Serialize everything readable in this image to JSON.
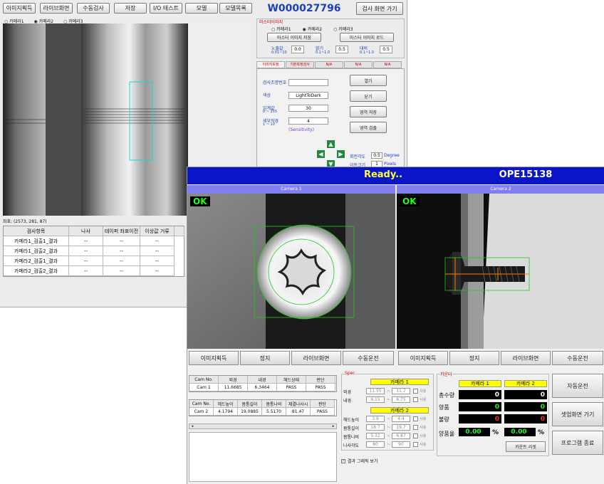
{
  "back": {
    "toolbar": [
      "이미지획득",
      "라이브화면",
      "수동검사",
      "저장",
      "I/O 테스트",
      "모델",
      "모델목록"
    ],
    "model_id": "W000027796",
    "exit_btn": "검사 화면 가기",
    "cam_radios": [
      "카메라1",
      "카메라2",
      "카메라3"
    ],
    "cam_radios_selected": 1,
    "master_group": "마스터이미지",
    "master_radios": [
      "카메라1",
      "카메라2",
      "카메라3"
    ],
    "master_save": "마스터 이미지 저장",
    "master_load": "마스터 이미지 로드",
    "params": [
      {
        "label": "노출값",
        "sub": "0.01~10",
        "value": "0.0"
      },
      {
        "label": "밝기",
        "sub": "0.1~1.0",
        "value": "0.5"
      },
      {
        "label": "대비",
        "sub": "0.1~1.0",
        "value": "0.5"
      }
    ],
    "tabs": [
      "이미지보정",
      "기본측정검사",
      "N/A",
      "N/A",
      "N/A"
    ],
    "form": [
      {
        "label": "검사조명번호",
        "value": ""
      },
      {
        "label": "색상",
        "value": "LightToDark"
      },
      {
        "label": "임계값",
        "sub": "0 ~ 255",
        "value": "30"
      },
      {
        "label": "세부직경",
        "sub": "1 ~ 10",
        "value": "4"
      }
    ],
    "form_note": "(Sensitivity)",
    "side_buttons": [
      "열기",
      "닫기",
      "영역 저장",
      "영역 검출"
    ],
    "move_labels": [
      {
        "label": "회전각도",
        "value": "0.5",
        "unit": "Degree"
      },
      {
        "label": "이동크기",
        "value": "1",
        "unit": "Pixels"
      }
    ],
    "status_line": "좌표: (2573, 281, 87)",
    "table_headers": [
      "검사항목",
      "나사",
      "테이퍼 좌표이전",
      "이상값 거류",
      ""
    ],
    "table_rows": [
      [
        "카메라1_검출1_결과",
        "--",
        "--",
        "--"
      ],
      [
        "카메라1_검출2_결과",
        "--",
        "--",
        "--"
      ],
      [
        "카메라2_검출1_결과",
        "--",
        "--",
        "--"
      ],
      [
        "카메라2_검출2_결과",
        "--",
        "--",
        "--"
      ]
    ]
  },
  "front": {
    "status": "Ready..",
    "station": "OPE15138",
    "camera1_title": "Camera 1",
    "camera2_title": "Camera 2",
    "ok_label": "OK",
    "cam_buttons": [
      "이미지획득",
      "정지",
      "라이브화면",
      "수동운전"
    ],
    "result1": {
      "headers": [
        "Cam No.",
        "외경",
        "내경",
        "헤드상태",
        "판단"
      ],
      "row": [
        "Cam 1",
        "11.6685",
        "6.3464",
        "PASS",
        "PASS"
      ]
    },
    "result2": {
      "headers": [
        "Cam No.",
        "헤드높이",
        "몸통길이",
        "몸통나비",
        "체결나사시",
        "판단"
      ],
      "row": [
        "Cam 2",
        "4.1794",
        "19.0885",
        "5.5170",
        "81.47",
        "PASS"
      ]
    },
    "spec": {
      "title": "Spec",
      "cam1_header": "카메라 1",
      "cam1_rows": [
        {
          "label": "외경",
          "min": "11.55",
          "max": "11.7",
          "use": "사용"
        },
        {
          "label": "내경",
          "min": "6.15",
          "max": "6.75",
          "use": "사용"
        }
      ],
      "cam2_header": "카메라 2",
      "cam2_rows": [
        {
          "label": "헤드높이",
          "min": "3.9",
          "max": "4.4",
          "use": "사용"
        },
        {
          "label": "몸통길이",
          "min": "18.7",
          "max": "19.7",
          "use": "사용"
        },
        {
          "label": "몸통나비",
          "min": "5.32",
          "max": "6.87",
          "use": "사용"
        },
        {
          "label": "나사각도",
          "min": "80",
          "max": "90",
          "use": "사용"
        }
      ]
    },
    "counter": {
      "title": "카운터",
      "col_headers": [
        "카메라 1",
        "카메라 2"
      ],
      "rows": [
        {
          "label": "총수량",
          "v1": "0",
          "v2": "0"
        },
        {
          "label": "양품",
          "v1": "0",
          "v2": "0"
        },
        {
          "label": "불량",
          "v1": "0",
          "v2": "0"
        }
      ],
      "yield_label": "양품율",
      "yield1": "0.00",
      "yield2": "0.00",
      "pct": "%",
      "reset": "카운트 리셋"
    },
    "right_buttons": [
      "자동운전",
      "셋업화면 가기",
      "프로그램 종료"
    ],
    "show_graph": "결과 그래픽 보기"
  }
}
